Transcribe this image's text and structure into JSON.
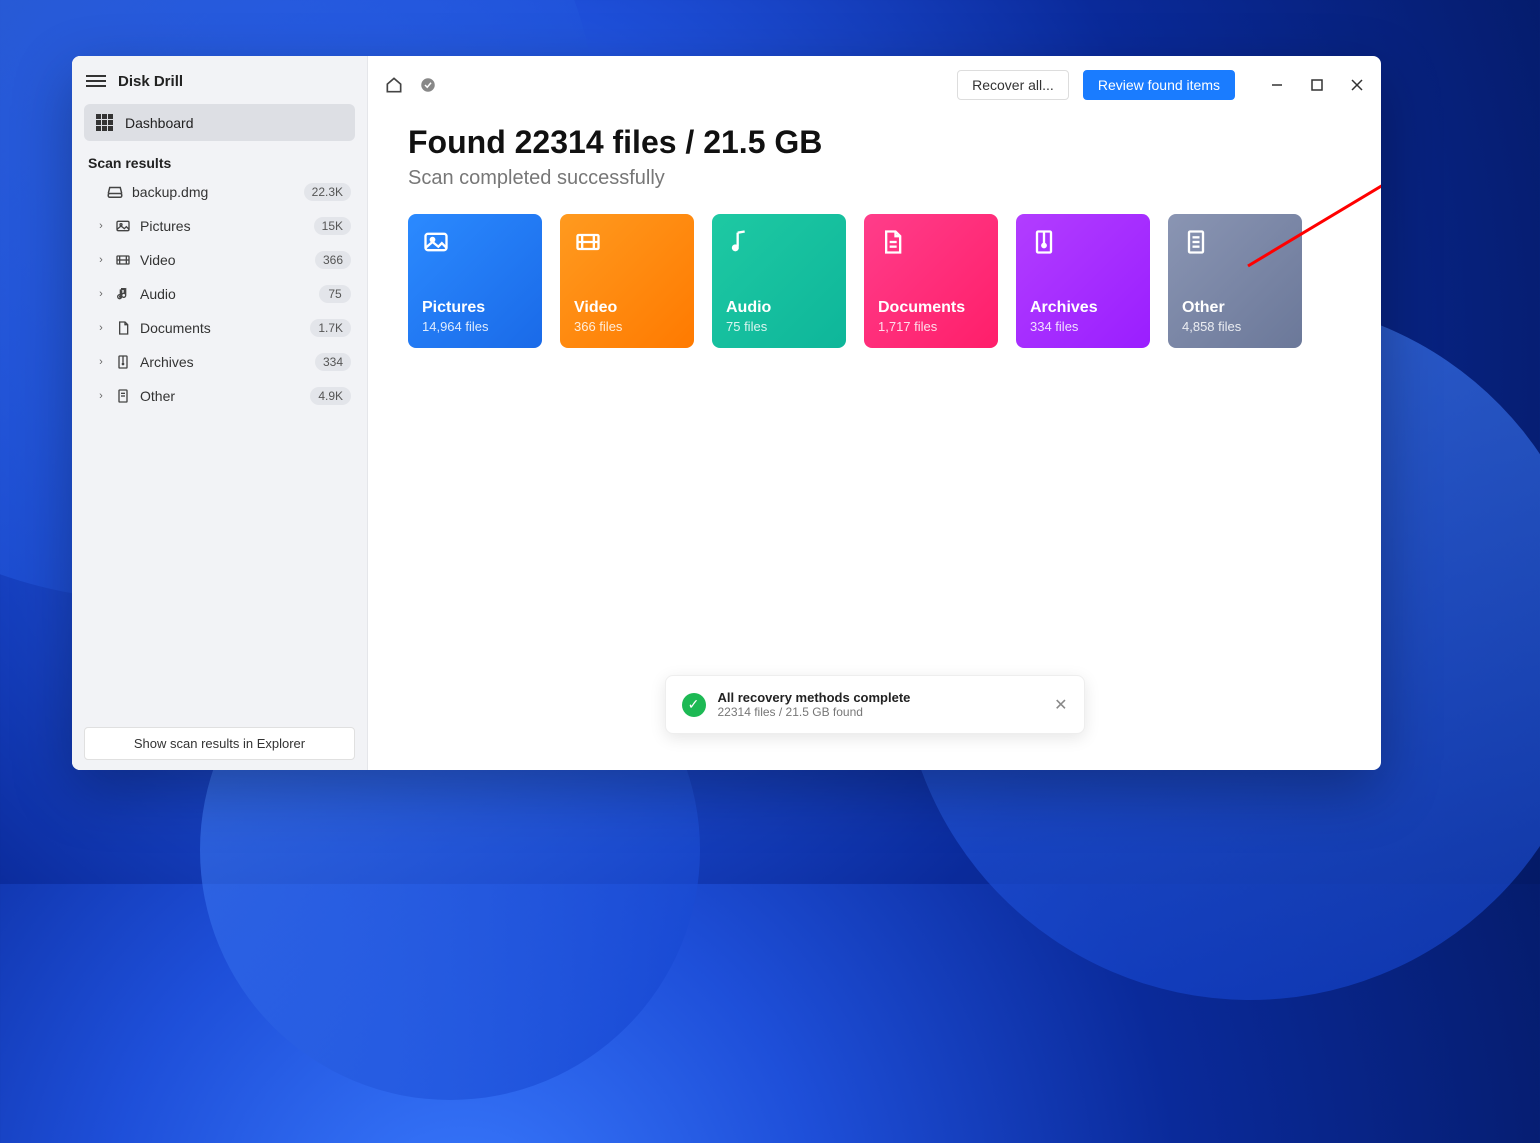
{
  "app": {
    "title": "Disk Drill"
  },
  "sidebar": {
    "dashboard_label": "Dashboard",
    "section_label": "Scan results",
    "root": {
      "label": "backup.dmg",
      "count": "22.3K"
    },
    "items": [
      {
        "label": "Pictures",
        "count": "15K"
      },
      {
        "label": "Video",
        "count": "366"
      },
      {
        "label": "Audio",
        "count": "75"
      },
      {
        "label": "Documents",
        "count": "1.7K"
      },
      {
        "label": "Archives",
        "count": "334"
      },
      {
        "label": "Other",
        "count": "4.9K"
      }
    ],
    "footer_button": "Show scan results in Explorer"
  },
  "toolbar": {
    "recover_all": "Recover all...",
    "review": "Review found items"
  },
  "content": {
    "headline": "Found 22314 files / 21.5 GB",
    "subhead": "Scan completed successfully",
    "cards": [
      {
        "title": "Pictures",
        "sub": "14,964 files",
        "class": "pictures"
      },
      {
        "title": "Video",
        "sub": "366 files",
        "class": "video"
      },
      {
        "title": "Audio",
        "sub": "75 files",
        "class": "audio"
      },
      {
        "title": "Documents",
        "sub": "1,717 files",
        "class": "documents"
      },
      {
        "title": "Archives",
        "sub": "334 files",
        "class": "archives"
      },
      {
        "title": "Other",
        "sub": "4,858 files",
        "class": "other"
      }
    ]
  },
  "toast": {
    "title": "All recovery methods complete",
    "sub": "22314 files / 21.5 GB found"
  }
}
